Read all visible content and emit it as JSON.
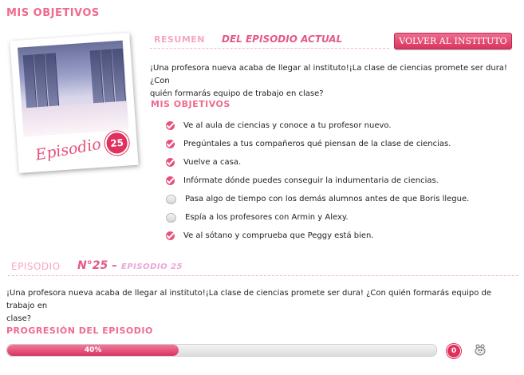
{
  "page_title": "MIS OBJETIVOS",
  "card": {
    "episode_word": "Episodio",
    "episode_number": "25"
  },
  "summary": {
    "label_a": "RESUMEN",
    "label_b": "DEL EPISODIO ACTUAL",
    "button": "VOLVER AL INSTITUTO",
    "line1": "¡Una profesora nueva acaba de llegar al instituto!¡La clase de ciencias promete ser dura! ¿Con",
    "line2": "quién formarás equipo de trabajo en clase?"
  },
  "objectives": {
    "heading": "MIS OBJETIVOS",
    "items": [
      {
        "text": "Ve al aula de ciencias y conoce a tu profesor nuevo.",
        "done": true
      },
      {
        "text": "Pregúntales a tus compañeros qué piensan de la clase de ciencias.",
        "done": true
      },
      {
        "text": "Vuelve a casa.",
        "done": true
      },
      {
        "text": "Infórmate dónde puedes conseguir la indumentaria de ciencias.",
        "done": true
      },
      {
        "text": "Pasa algo de tiempo con los demás alumnos antes de que Boris llegue.",
        "done": false
      },
      {
        "text": "Espía a los profesores con Armin y Alexy.",
        "done": false
      },
      {
        "text": "Ve al sótano y comprueba que Peggy está bien.",
        "done": true
      }
    ]
  },
  "episode": {
    "label": "EPISODIO",
    "number": "N°25 –",
    "sub": "EPISODIO 25",
    "line1": "¡Una profesora nueva acaba de llegar al instituto!¡La clase de ciencias promete ser dura! ¿Con quién formarás equipo de trabajo en",
    "line2": "clase?"
  },
  "progress": {
    "heading": "PROGRESIÓN DEL EPISODIO",
    "value": 0.4,
    "label": "40%",
    "count": "0"
  },
  "icons": {
    "check": "check-icon",
    "hamster": "hamster-icon"
  },
  "colors": {
    "accent": "#e8507a",
    "accent_light": "#f6a8bd",
    "badge": "#e0305e"
  }
}
